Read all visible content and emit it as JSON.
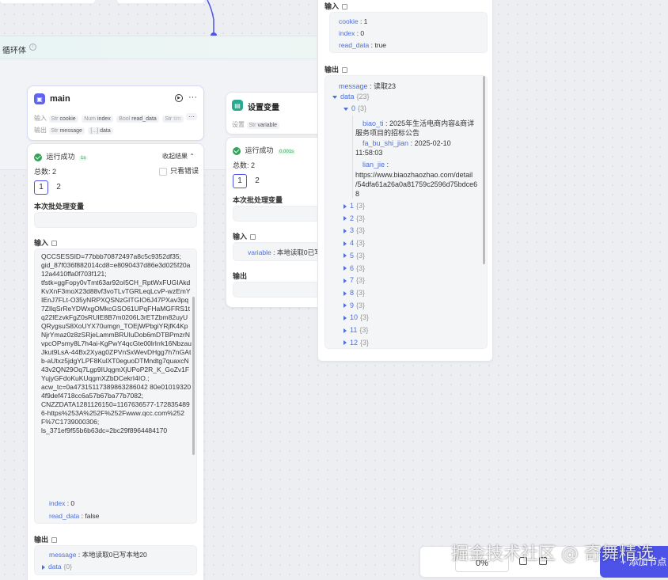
{
  "loop": {
    "title": "循环体"
  },
  "main_node": {
    "title": "main",
    "input_label": "输入",
    "inputs": [
      {
        "type": "Str",
        "name": "cookie"
      },
      {
        "type": "Num",
        "name": "index"
      },
      {
        "type": "Bool",
        "name": "read_data"
      },
      {
        "type": "Str",
        "name": "tim"
      }
    ],
    "more": "···",
    "output_label": "输出",
    "outputs": [
      {
        "type": "Str",
        "name": "message"
      },
      {
        "type": "[...]",
        "name": "data"
      }
    ]
  },
  "var_node": {
    "title": "设置变量",
    "set_label": "设置",
    "var_chip": {
      "type": "Str",
      "name": "variable"
    },
    "status": "运行成功",
    "badge": "0.001s",
    "total": "总数: 2",
    "tabs": [
      "1",
      "2"
    ],
    "batch_var": "本次批处理变量",
    "input_title": "输入",
    "input_key": "variable",
    "input_val": "本地读取0已写",
    "output_title": "输出"
  },
  "main_result": {
    "status": "运行成功",
    "badge": "1s",
    "collapse": "收起结果",
    "only_err": "只看错误",
    "total": "总数: 2",
    "tabs": [
      "1",
      "2"
    ],
    "batch_var": "本次批处理变量",
    "input_title": "输入",
    "cookie_text": "QCCSESSID=77bbb70872497a8c5c9352df35;\ngid_87f036f882014cd8=e8090437d86e3d025f20a12a4410ffa0f703f121;\ntfstk=ggFopy0vTmt63ar92oI5CH_RptWxFUGIAkdKvXnF3moX23d88vf3voTLvTGRLeqLcvP-wzEmYIEnJ7FLt-O35yNRPXQSNzGITGIO6J47PXav3pq7ZIlqSrReYDWxgOMkcGSO61UPqFHaMGFRS1tq22IEzvkFgZ0sRUIE8B7m0206L3rETZbm82uyUQRygsuS8XoUYX70umgn_TOEjWPbgiYRjfK4KpNjrYmaz0z8zSRjeLammBRUIuDob6mDTBPmzrNvpcOPsmy8L7h4ai-KgPwY4qcGte00lrIrrk16NbzauJkut9LsA-44Bx2Xyag0ZPVnSxWevDHgg7h7nGAtb-aUtxz5jdgYLPF8KulXT0eguoDTMndtg7quaxcN43v2QN29Oq7Lgp9IUqgmXjUPoP2R_K_GoZv1FYujyGFdoKuKUqgmXZbDCekrI4IO.;\nacw_tc=0a47315117389863286042 80e010193204f9def4718cc6a57b67ba77b7082;\nCNZZDATA1281126150=1167636577-1728354896-https%253A%252F%252Fwww.qcc.com%252F%7C1739000306;\nls_371ef9f55b6b63dc=2bc29f8964484170",
    "index_key": "index",
    "index_val": "0",
    "read_key": "read_data",
    "read_val": "false",
    "output_title": "输出",
    "msg_key": "message",
    "msg_val": "本地读取0已写本地20",
    "data_key": "data",
    "data_cnt": "{0}"
  },
  "side_panel": {
    "input_title": "输入",
    "cookie_key": "cookie",
    "cookie_val": "1",
    "index_key": "index",
    "index_val": "0",
    "read_key": "read_data",
    "read_val": "true",
    "output_title": "输出",
    "msg_key": "message",
    "msg_val": "读取23",
    "data_key": "data",
    "data_cnt": "{23}",
    "item0_key": "0",
    "item0_cnt": "{3}",
    "biao_key": "biao_ti",
    "biao_val": "2025年生活电商内容&商详",
    "biao_val2": "服务项目的招标公告",
    "fa_key": "fa_bu_shi_jian",
    "fa_val": "2025-02-10",
    "fa_val2": "11:58:03",
    "lian_key": "lian_jie",
    "lian_l1": "https://www.biaozhaozhao.com/detail",
    "lian_l2": "/54dfa61a26a0a81759c2596d75bdce6",
    "lian_l3": "8",
    "items": [
      "1",
      "2",
      "3",
      "4",
      "5",
      "6",
      "7",
      "8",
      "9",
      "10",
      "11",
      "12"
    ],
    "item_cnt": "{3}"
  },
  "bottom": {
    "zoom": "0%",
    "add_node": "+ 添加节点"
  },
  "watermark": "掘金技术社区 @ 奇舞精选",
  "colors": {
    "accent": "#4d53e8",
    "success": "#31a357",
    "key": "#4d6fd8"
  }
}
